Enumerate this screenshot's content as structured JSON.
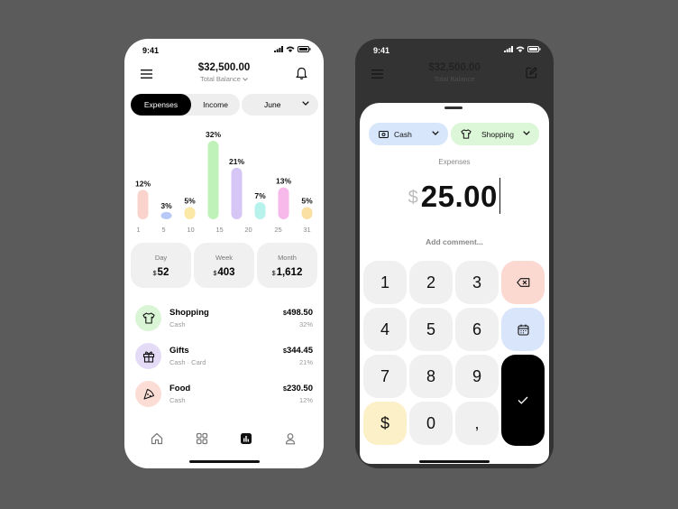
{
  "colors": {
    "background": "#5b5b5b",
    "accent": "#000000"
  },
  "left": {
    "status": {
      "time": "9:41"
    },
    "header": {
      "balance": "$32,500.00",
      "balance_label": "Total Balance"
    },
    "tabs": {
      "expenses": "Expenses",
      "income": "Income",
      "active": "Expenses"
    },
    "month": "June",
    "chart_data": {
      "type": "bar",
      "categories": [
        "1",
        "5",
        "10",
        "15",
        "20",
        "25",
        "31"
      ],
      "x_ticks": [
        "1",
        "5",
        "10",
        "15",
        "20",
        "25",
        "31"
      ],
      "values": [
        12,
        3,
        5,
        32,
        21,
        7,
        13,
        5
      ],
      "labels": [
        "12%",
        "3%",
        "5%",
        "32%",
        "21%",
        "7%",
        "13%",
        "5%"
      ],
      "colors": [
        "#fad4cc",
        "#b7c9f7",
        "#fbe7a6",
        "#bff2b9",
        "#d6c6f5",
        "#b8f2ec",
        "#f7b9ea",
        "#fbe0a3"
      ],
      "ylim": [
        0,
        32
      ]
    },
    "stats": [
      {
        "label": "Day",
        "currency": "$",
        "value": "52"
      },
      {
        "label": "Week",
        "currency": "$",
        "value": "403"
      },
      {
        "label": "Month",
        "currency": "$",
        "value": "1,612"
      }
    ],
    "categories": [
      {
        "name": "Shopping",
        "meta": "Cash",
        "currency": "$",
        "amount": "498.50",
        "percent": "32%",
        "icon": "tshirt-icon",
        "color": "#d9f5d5"
      },
      {
        "name": "Gifts",
        "meta": "Cash · Card",
        "currency": "$",
        "amount": "344.45",
        "percent": "21%",
        "icon": "gift-icon",
        "color": "#e4dcf7"
      },
      {
        "name": "Food",
        "meta": "Cash",
        "currency": "$",
        "amount": "230.50",
        "percent": "12%",
        "icon": "pizza-icon",
        "color": "#fbddd6"
      }
    ],
    "tabbar": [
      "home-icon",
      "grid-icon",
      "stats-icon",
      "profile-icon"
    ]
  },
  "right": {
    "status": {
      "time": "9:41"
    },
    "header": {
      "balance": "$32,500.00",
      "balance_label": "Total Balance"
    },
    "account": {
      "label": "Cash",
      "color": "#d8e6fb"
    },
    "category": {
      "label": "Shopping",
      "color": "#dcf6d8"
    },
    "type_label": "Expenses",
    "currency": "$",
    "amount": "25.00",
    "comment_placeholder": "Add comment...",
    "keys": [
      "1",
      "2",
      "3",
      "4",
      "5",
      "6",
      "7",
      "8",
      "9",
      "$",
      "0",
      ","
    ],
    "key_colors": {
      "backspace": "#fbd9d0",
      "calendar": "#d9e5fb",
      "currency": "#fcf0c8",
      "confirm": "#000000"
    }
  }
}
